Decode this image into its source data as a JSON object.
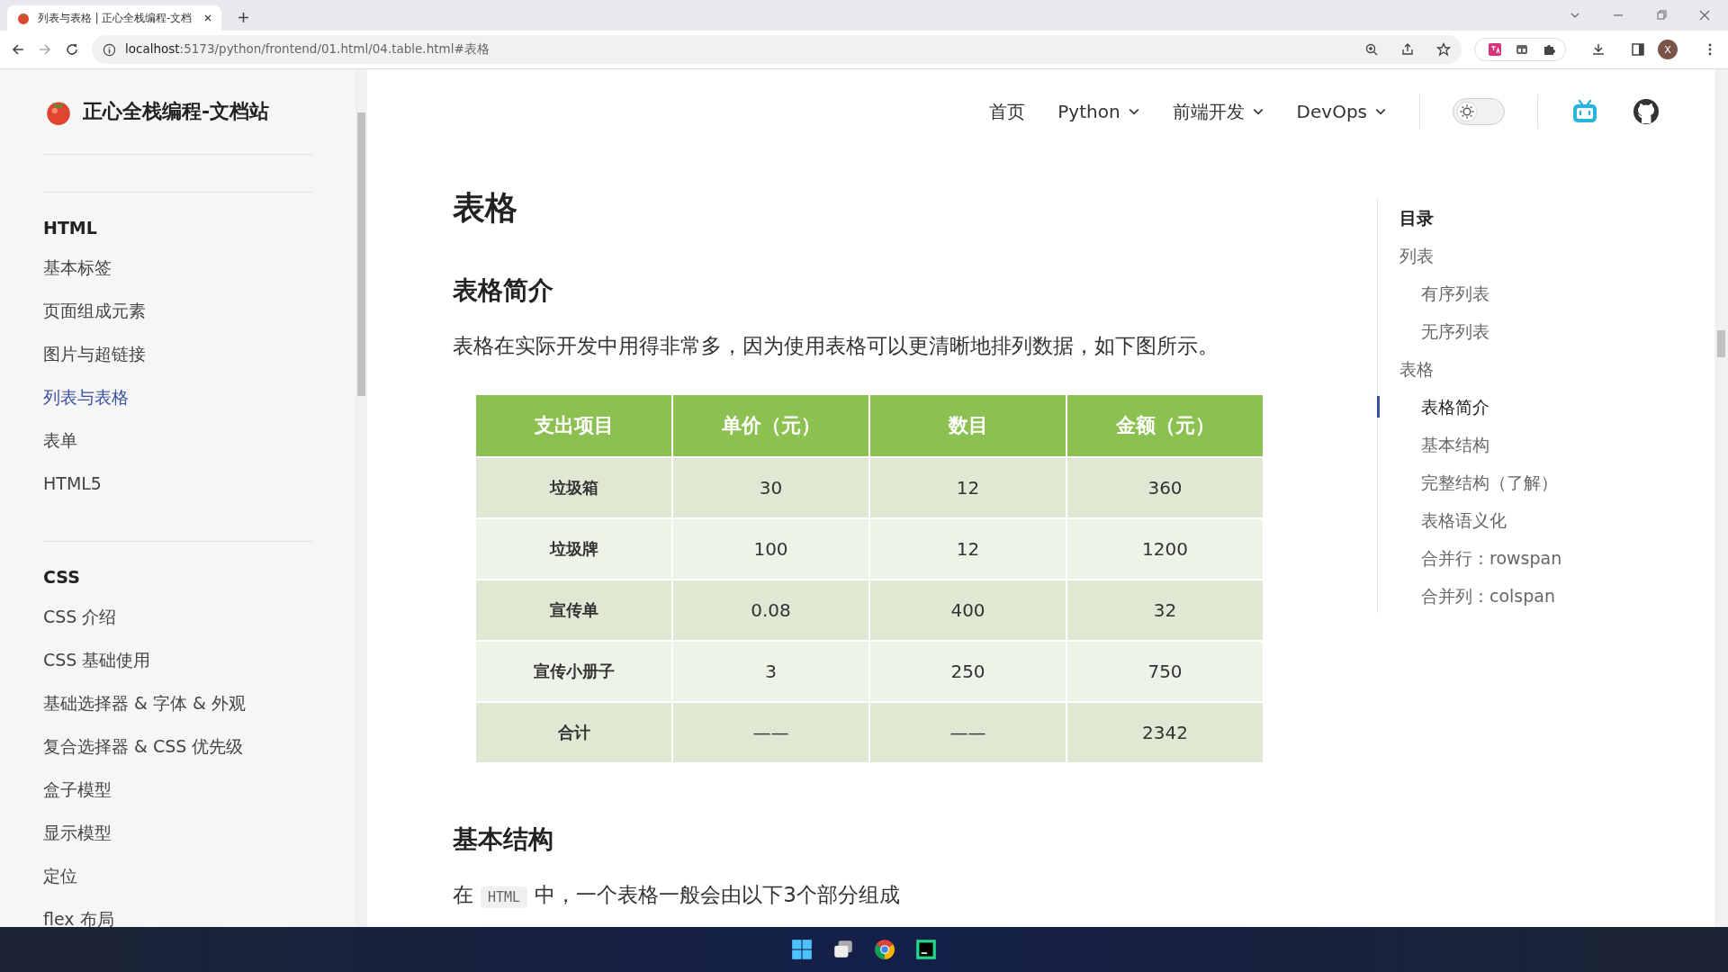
{
  "browser": {
    "tab_title": "列表与表格 | 正心全栈编程-文档",
    "url_host": "localhost",
    "url_path": ":5173/python/frontend/01.html/04.table.html#表格",
    "profile_initial": "X"
  },
  "site": {
    "title": "正心全栈编程-文档站",
    "nav": [
      {
        "label": "首页",
        "dropdown": false
      },
      {
        "label": "Python",
        "dropdown": true
      },
      {
        "label": "前端开发",
        "dropdown": true
      },
      {
        "label": "DevOps",
        "dropdown": true
      }
    ],
    "dark_mode": false
  },
  "sidebar": {
    "sections": [
      {
        "title": "HTML",
        "items": [
          {
            "label": "基本标签",
            "selected": false
          },
          {
            "label": "页面组成元素",
            "selected": false
          },
          {
            "label": "图片与超链接",
            "selected": false
          },
          {
            "label": "列表与表格",
            "selected": true
          },
          {
            "label": "表单",
            "selected": false
          },
          {
            "label": "HTML5",
            "selected": false
          }
        ]
      },
      {
        "title": "CSS",
        "items": [
          {
            "label": "CSS 介绍",
            "selected": false
          },
          {
            "label": "CSS 基础使用",
            "selected": false
          },
          {
            "label": "基础选择器 & 字体 & 外观",
            "selected": false
          },
          {
            "label": "复合选择器 & CSS 优先级",
            "selected": false
          },
          {
            "label": "盒子模型",
            "selected": false
          },
          {
            "label": "显示模型",
            "selected": false
          },
          {
            "label": "定位",
            "selected": false
          },
          {
            "label": "flex 布局",
            "selected": false
          }
        ]
      }
    ]
  },
  "content": {
    "title": "表格",
    "sections": [
      {
        "heading": "表格简介",
        "text": "表格在实际开发中用得非常多，因为使用表格可以更清晰地排列数据，如下图所示。",
        "table": {
          "columns": [
            "支出项目",
            "单价（元）",
            "数目",
            "金额（元）"
          ],
          "rows": [
            [
              "垃圾箱",
              "30",
              "12",
              "360"
            ],
            [
              "垃圾牌",
              "100",
              "12",
              "1200"
            ],
            [
              "宣传单",
              "0.08",
              "400",
              "32"
            ],
            [
              "宣传小册子",
              "3",
              "250",
              "750"
            ],
            [
              "合计",
              "——",
              "——",
              "2342"
            ]
          ]
        }
      },
      {
        "heading": "基本结构",
        "text_before": "在",
        "code": "HTML",
        "text_after": "中，一个表格一般会由以下3个部分组成"
      }
    ]
  },
  "toc": {
    "title": "目录",
    "items": [
      {
        "label": "列表",
        "selected": false,
        "children": [
          {
            "label": "有序列表",
            "selected": false
          },
          {
            "label": "无序列表",
            "selected": false
          }
        ]
      },
      {
        "label": "表格",
        "selected": false,
        "children": [
          {
            "label": "表格简介",
            "selected": true
          },
          {
            "label": "基本结构",
            "selected": false
          },
          {
            "label": "完整结构（了解）",
            "selected": false
          },
          {
            "label": "表格语义化",
            "selected": false
          },
          {
            "label": "合并行：rowspan",
            "selected": false
          },
          {
            "label": "合并列：colspan",
            "selected": false
          }
        ]
      }
    ]
  }
}
